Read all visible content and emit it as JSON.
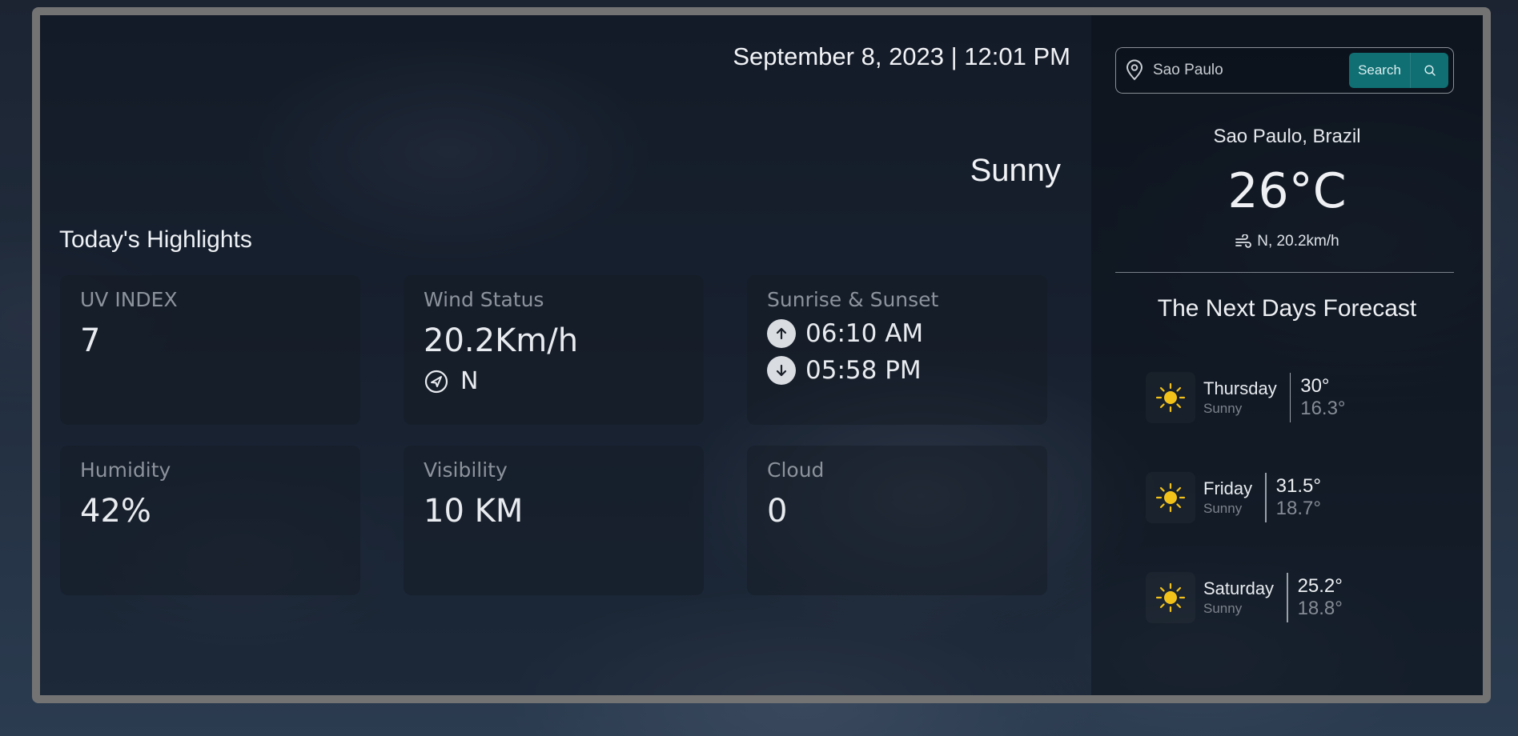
{
  "header": {
    "datetime": "September 8, 2023 | 12:01 PM",
    "condition": "Sunny"
  },
  "highlights": {
    "title": "Today's Highlights",
    "uv": {
      "label": "UV INDEX",
      "value": "7"
    },
    "wind": {
      "label": "Wind Status",
      "value": "20.2Km/h",
      "direction": "N"
    },
    "sun": {
      "label": "Sunrise & Sunset",
      "sunrise": "06:10 AM",
      "sunset": "05:58 PM"
    },
    "humidity": {
      "label": "Humidity",
      "value": "42%"
    },
    "visibility": {
      "label": "Visibility",
      "value": "10 KM"
    },
    "cloud": {
      "label": "Cloud",
      "value": "0"
    }
  },
  "search": {
    "value": "Sao Paulo",
    "button_label": "Search"
  },
  "current": {
    "location": "Sao Paulo, Brazil",
    "temperature": "26°C",
    "wind": "N, 20.2km/h"
  },
  "forecast": {
    "title": "The Next Days Forecast",
    "days": [
      {
        "day": "Thursday",
        "condition": "Sunny",
        "high": "30°",
        "low": "16.3°"
      },
      {
        "day": "Friday",
        "condition": "Sunny",
        "high": "31.5°",
        "low": "18.7°"
      },
      {
        "day": "Saturday",
        "condition": "Sunny",
        "high": "25.2°",
        "low": "18.8°"
      }
    ]
  },
  "icons": {
    "location": "map-pin-icon",
    "search": "search-icon",
    "wind": "wind-icon",
    "direction": "navigation-arrow-icon",
    "sunrise": "arrow-up-circle-icon",
    "sunset": "arrow-down-circle-icon",
    "forecast": "sun-icon"
  },
  "colors": {
    "accent": "#0f6f73",
    "frame": "#737373",
    "sun": "#f2c21b"
  }
}
